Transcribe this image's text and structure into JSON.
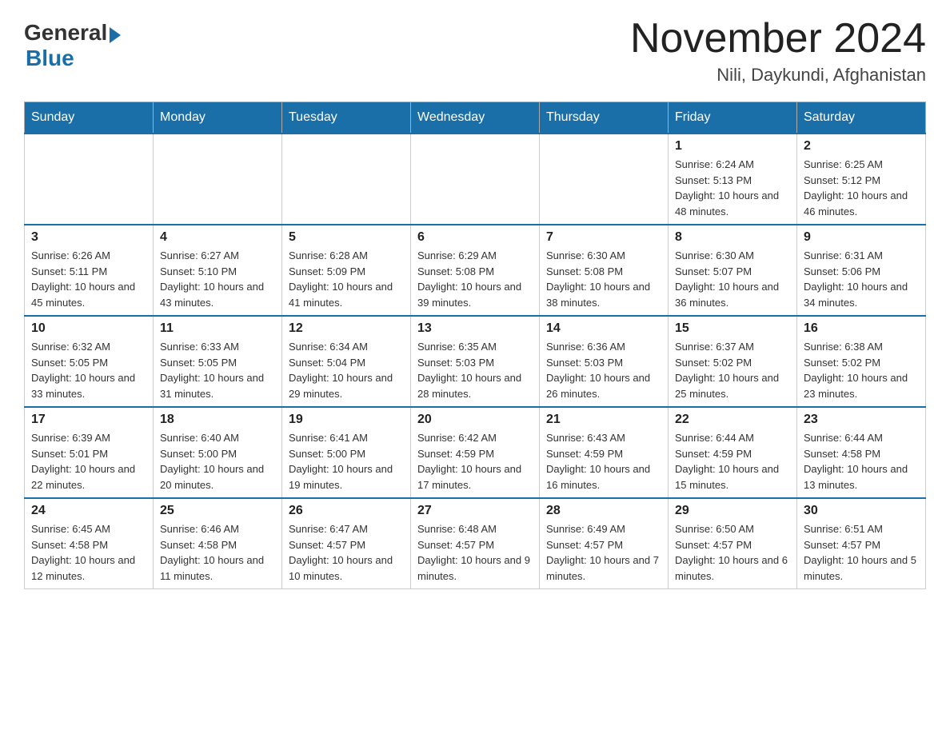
{
  "header": {
    "logo_general": "General",
    "logo_blue": "Blue",
    "month_title": "November 2024",
    "location": "Nili, Daykundi, Afghanistan"
  },
  "days_of_week": [
    "Sunday",
    "Monday",
    "Tuesday",
    "Wednesday",
    "Thursday",
    "Friday",
    "Saturday"
  ],
  "weeks": [
    [
      {
        "day": "",
        "info": ""
      },
      {
        "day": "",
        "info": ""
      },
      {
        "day": "",
        "info": ""
      },
      {
        "day": "",
        "info": ""
      },
      {
        "day": "",
        "info": ""
      },
      {
        "day": "1",
        "info": "Sunrise: 6:24 AM\nSunset: 5:13 PM\nDaylight: 10 hours and 48 minutes."
      },
      {
        "day": "2",
        "info": "Sunrise: 6:25 AM\nSunset: 5:12 PM\nDaylight: 10 hours and 46 minutes."
      }
    ],
    [
      {
        "day": "3",
        "info": "Sunrise: 6:26 AM\nSunset: 5:11 PM\nDaylight: 10 hours and 45 minutes."
      },
      {
        "day": "4",
        "info": "Sunrise: 6:27 AM\nSunset: 5:10 PM\nDaylight: 10 hours and 43 minutes."
      },
      {
        "day": "5",
        "info": "Sunrise: 6:28 AM\nSunset: 5:09 PM\nDaylight: 10 hours and 41 minutes."
      },
      {
        "day": "6",
        "info": "Sunrise: 6:29 AM\nSunset: 5:08 PM\nDaylight: 10 hours and 39 minutes."
      },
      {
        "day": "7",
        "info": "Sunrise: 6:30 AM\nSunset: 5:08 PM\nDaylight: 10 hours and 38 minutes."
      },
      {
        "day": "8",
        "info": "Sunrise: 6:30 AM\nSunset: 5:07 PM\nDaylight: 10 hours and 36 minutes."
      },
      {
        "day": "9",
        "info": "Sunrise: 6:31 AM\nSunset: 5:06 PM\nDaylight: 10 hours and 34 minutes."
      }
    ],
    [
      {
        "day": "10",
        "info": "Sunrise: 6:32 AM\nSunset: 5:05 PM\nDaylight: 10 hours and 33 minutes."
      },
      {
        "day": "11",
        "info": "Sunrise: 6:33 AM\nSunset: 5:05 PM\nDaylight: 10 hours and 31 minutes."
      },
      {
        "day": "12",
        "info": "Sunrise: 6:34 AM\nSunset: 5:04 PM\nDaylight: 10 hours and 29 minutes."
      },
      {
        "day": "13",
        "info": "Sunrise: 6:35 AM\nSunset: 5:03 PM\nDaylight: 10 hours and 28 minutes."
      },
      {
        "day": "14",
        "info": "Sunrise: 6:36 AM\nSunset: 5:03 PM\nDaylight: 10 hours and 26 minutes."
      },
      {
        "day": "15",
        "info": "Sunrise: 6:37 AM\nSunset: 5:02 PM\nDaylight: 10 hours and 25 minutes."
      },
      {
        "day": "16",
        "info": "Sunrise: 6:38 AM\nSunset: 5:02 PM\nDaylight: 10 hours and 23 minutes."
      }
    ],
    [
      {
        "day": "17",
        "info": "Sunrise: 6:39 AM\nSunset: 5:01 PM\nDaylight: 10 hours and 22 minutes."
      },
      {
        "day": "18",
        "info": "Sunrise: 6:40 AM\nSunset: 5:00 PM\nDaylight: 10 hours and 20 minutes."
      },
      {
        "day": "19",
        "info": "Sunrise: 6:41 AM\nSunset: 5:00 PM\nDaylight: 10 hours and 19 minutes."
      },
      {
        "day": "20",
        "info": "Sunrise: 6:42 AM\nSunset: 4:59 PM\nDaylight: 10 hours and 17 minutes."
      },
      {
        "day": "21",
        "info": "Sunrise: 6:43 AM\nSunset: 4:59 PM\nDaylight: 10 hours and 16 minutes."
      },
      {
        "day": "22",
        "info": "Sunrise: 6:44 AM\nSunset: 4:59 PM\nDaylight: 10 hours and 15 minutes."
      },
      {
        "day": "23",
        "info": "Sunrise: 6:44 AM\nSunset: 4:58 PM\nDaylight: 10 hours and 13 minutes."
      }
    ],
    [
      {
        "day": "24",
        "info": "Sunrise: 6:45 AM\nSunset: 4:58 PM\nDaylight: 10 hours and 12 minutes."
      },
      {
        "day": "25",
        "info": "Sunrise: 6:46 AM\nSunset: 4:58 PM\nDaylight: 10 hours and 11 minutes."
      },
      {
        "day": "26",
        "info": "Sunrise: 6:47 AM\nSunset: 4:57 PM\nDaylight: 10 hours and 10 minutes."
      },
      {
        "day": "27",
        "info": "Sunrise: 6:48 AM\nSunset: 4:57 PM\nDaylight: 10 hours and 9 minutes."
      },
      {
        "day": "28",
        "info": "Sunrise: 6:49 AM\nSunset: 4:57 PM\nDaylight: 10 hours and 7 minutes."
      },
      {
        "day": "29",
        "info": "Sunrise: 6:50 AM\nSunset: 4:57 PM\nDaylight: 10 hours and 6 minutes."
      },
      {
        "day": "30",
        "info": "Sunrise: 6:51 AM\nSunset: 4:57 PM\nDaylight: 10 hours and 5 minutes."
      }
    ]
  ]
}
